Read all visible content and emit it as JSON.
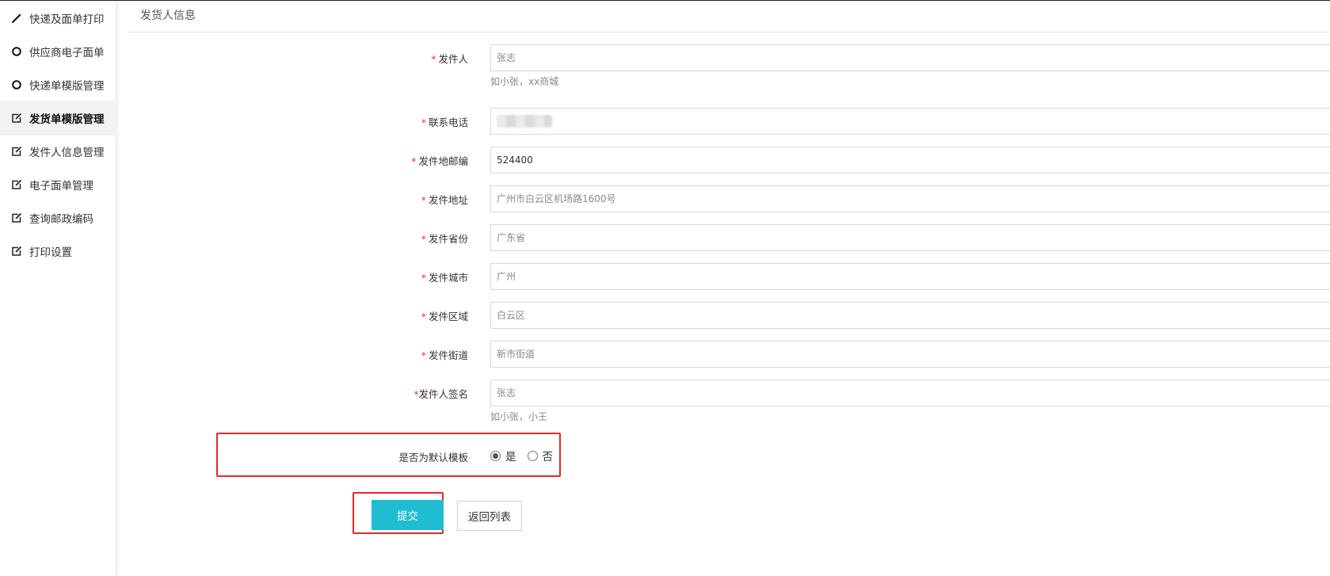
{
  "sidebar": {
    "items": [
      {
        "label": "快递及面单打印",
        "icon": "magic-wand-icon",
        "active": false
      },
      {
        "label": "供应商电子面单",
        "icon": "circle-icon",
        "active": false
      },
      {
        "label": "快递单模版管理",
        "icon": "circle-icon",
        "active": false
      },
      {
        "label": "发货单模版管理",
        "icon": "edit-icon",
        "active": true
      },
      {
        "label": "发件人信息管理",
        "icon": "edit-icon",
        "active": false
      },
      {
        "label": "电子面单管理",
        "icon": "edit-icon",
        "active": false
      },
      {
        "label": "查询邮政编码",
        "icon": "edit-icon",
        "active": false
      },
      {
        "label": "打印设置",
        "icon": "edit-icon",
        "active": false
      }
    ]
  },
  "header": {
    "title": "发货人信息"
  },
  "form": {
    "required_mark": "*",
    "sender": {
      "label": "发件人",
      "placeholder": "张志",
      "hint": "如小张，xx商城"
    },
    "phone": {
      "label": "联系电话",
      "value": ""
    },
    "postcode": {
      "label": "发件地邮编",
      "value": "524400"
    },
    "address": {
      "label": "发件地址",
      "placeholder": "广州市白云区机场路1600号"
    },
    "province": {
      "label": "发件省份",
      "placeholder": "广东省"
    },
    "city": {
      "label": "发件城市",
      "placeholder": "广州"
    },
    "district": {
      "label": "发件区域",
      "placeholder": "白云区"
    },
    "street": {
      "label": "发件街道",
      "placeholder": "新市街道"
    },
    "signature": {
      "label": "发件人签名",
      "placeholder": "张志",
      "hint": "如小张，小王"
    },
    "default_template": {
      "label": "是否为默认模板",
      "yes": "是",
      "no": "否",
      "selected": "是"
    }
  },
  "buttons": {
    "submit": "提交",
    "back": "返回列表"
  },
  "colors": {
    "accent": "#1fbcd2",
    "required": "#e4393c",
    "highlight": "#e62828"
  }
}
